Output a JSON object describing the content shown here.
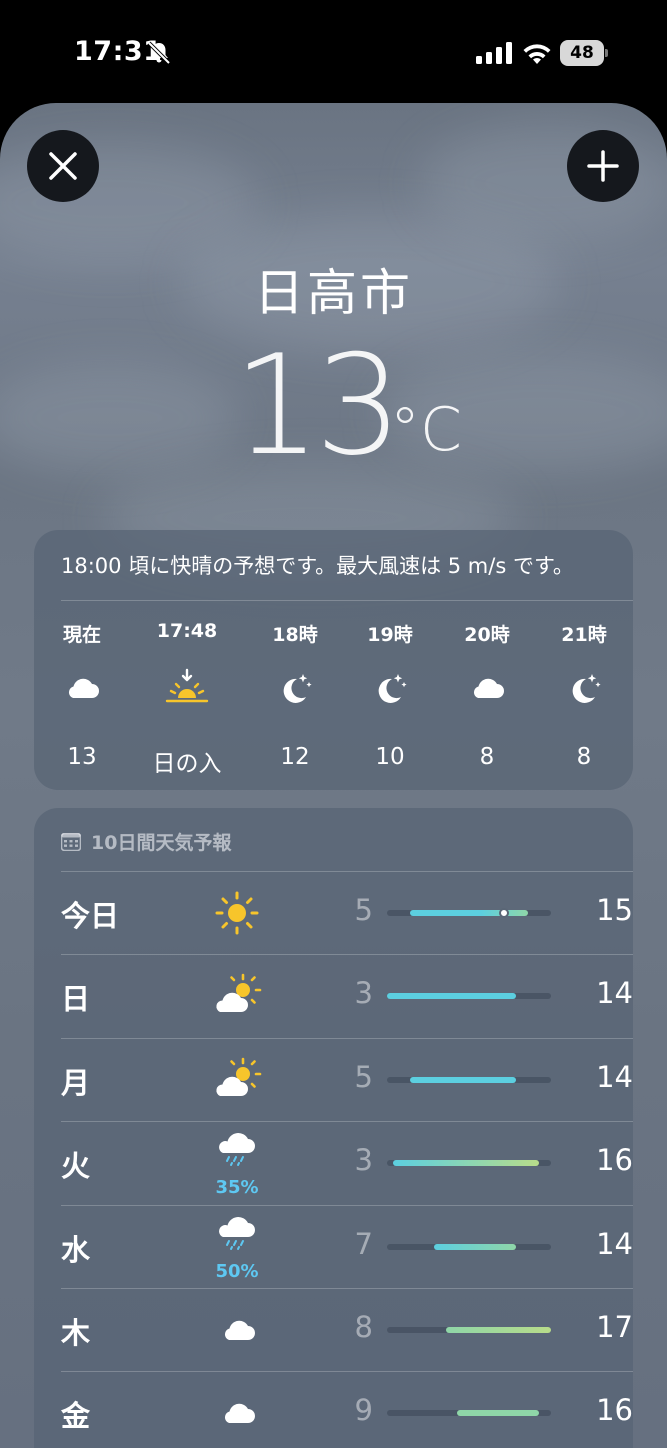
{
  "status": {
    "time": "17:31",
    "battery": "48"
  },
  "header": {
    "city": "日高市",
    "temperature": "13",
    "unit": "°C"
  },
  "hourly": {
    "summary": "18:00 頃に快晴の予想です。最大風速は 5 m/s です。",
    "items": [
      {
        "label": "現在",
        "icon": "cloud-icon",
        "temp": "13"
      },
      {
        "label": "17:48",
        "icon": "sunset-icon",
        "temp": "日の入"
      },
      {
        "label": "18時",
        "icon": "moon-stars-icon",
        "temp": "12"
      },
      {
        "label": "19時",
        "icon": "moon-stars-icon",
        "temp": "10"
      },
      {
        "label": "20時",
        "icon": "cloud-icon",
        "temp": "8"
      },
      {
        "label": "21時",
        "icon": "moon-stars-icon",
        "temp": "8"
      }
    ]
  },
  "forecast": {
    "title": "10日間天気予報",
    "scale": [
      3,
      17
    ],
    "days": [
      {
        "day": "今日",
        "icon": "sun-icon",
        "precip": "",
        "low": "5",
        "high": "15",
        "range_low": 5,
        "range_high": 15,
        "current": 13
      },
      {
        "day": "日",
        "icon": "partly-cloudy-icon",
        "precip": "",
        "low": "3",
        "high": "14",
        "range_low": 3,
        "range_high": 14
      },
      {
        "day": "月",
        "icon": "partly-cloudy-icon",
        "precip": "",
        "low": "5",
        "high": "14",
        "range_low": 5,
        "range_high": 14
      },
      {
        "day": "火",
        "icon": "rain-icon",
        "precip": "35%",
        "low": "3",
        "high": "16",
        "range_low": 3.5,
        "range_high": 16
      },
      {
        "day": "水",
        "icon": "rain-icon",
        "precip": "50%",
        "low": "7",
        "high": "14",
        "range_low": 7,
        "range_high": 14
      },
      {
        "day": "木",
        "icon": "cloud-icon",
        "precip": "",
        "low": "8",
        "high": "17",
        "range_low": 8,
        "range_high": 17
      },
      {
        "day": "金",
        "icon": "cloud-icon",
        "precip": "",
        "low": "9",
        "high": "16",
        "range_low": 9,
        "range_high": 16
      }
    ]
  },
  "colors": {
    "cool": "#5ccfe0",
    "mild": "#8fd6a8",
    "warm": "#b8dc8a",
    "precip": "#5ec8f2"
  }
}
